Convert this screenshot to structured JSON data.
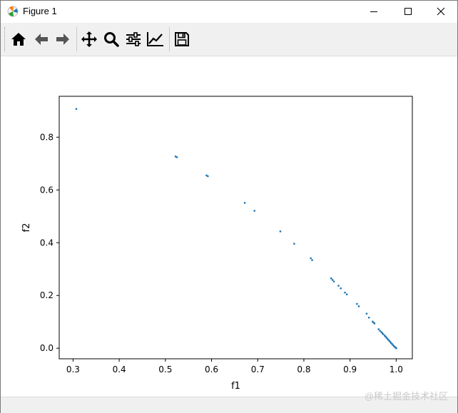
{
  "window": {
    "title": "Figure 1",
    "app_icon": "matplotlib-icon",
    "controls": [
      {
        "name": "minimize-button",
        "icon": "minimize-icon"
      },
      {
        "name": "maximize-button",
        "icon": "maximize-icon"
      },
      {
        "name": "close-button",
        "icon": "close-icon"
      }
    ]
  },
  "toolbar": {
    "buttons": [
      {
        "name": "home-button",
        "icon": "home-icon"
      },
      {
        "name": "back-button",
        "icon": "arrow-left-icon"
      },
      {
        "name": "forward-button",
        "icon": "arrow-right-icon"
      },
      {
        "name": "pan-button",
        "icon": "move-icon"
      },
      {
        "name": "zoom-button",
        "icon": "magnifier-icon"
      },
      {
        "name": "subplots-button",
        "icon": "sliders-icon"
      },
      {
        "name": "edit-axes-button",
        "icon": "line-chart-icon"
      },
      {
        "name": "save-button",
        "icon": "floppy-disk-icon"
      }
    ]
  },
  "chart_data": {
    "type": "scatter",
    "title": "",
    "xlabel": "f1",
    "ylabel": "f2",
    "xlim": [
      0.27,
      1.035
    ],
    "ylim": [
      -0.04,
      0.955
    ],
    "xticks": [
      "0.3",
      "0.4",
      "0.5",
      "0.6",
      "0.7",
      "0.8",
      "0.9",
      "1.0"
    ],
    "yticks": [
      "0.0",
      "0.2",
      "0.4",
      "0.6",
      "0.8"
    ],
    "marker_color": "#1f77b4",
    "x": [
      0.307,
      0.522,
      0.525,
      0.589,
      0.592,
      0.672,
      0.693,
      0.749,
      0.779,
      0.815,
      0.818,
      0.859,
      0.862,
      0.865,
      0.875,
      0.88,
      0.889,
      0.893,
      0.915,
      0.919,
      0.936,
      0.941,
      0.949,
      0.951,
      0.953,
      0.962,
      0.965,
      0.968,
      0.97,
      0.972,
      0.975,
      0.977,
      0.979,
      0.981,
      0.983,
      0.985,
      0.987,
      0.989,
      0.991,
      0.993,
      0.995,
      0.997,
      0.999,
      1.0
    ],
    "y": [
      0.907,
      0.727,
      0.724,
      0.655,
      0.652,
      0.551,
      0.521,
      0.443,
      0.396,
      0.341,
      0.334,
      0.265,
      0.259,
      0.253,
      0.237,
      0.227,
      0.211,
      0.204,
      0.168,
      0.159,
      0.131,
      0.116,
      0.101,
      0.097,
      0.094,
      0.072,
      0.066,
      0.061,
      0.057,
      0.053,
      0.048,
      0.044,
      0.04,
      0.036,
      0.032,
      0.028,
      0.024,
      0.02,
      0.016,
      0.012,
      0.008,
      0.005,
      0.002,
      0.0
    ]
  },
  "watermark": "@稀土掘金技术社区"
}
